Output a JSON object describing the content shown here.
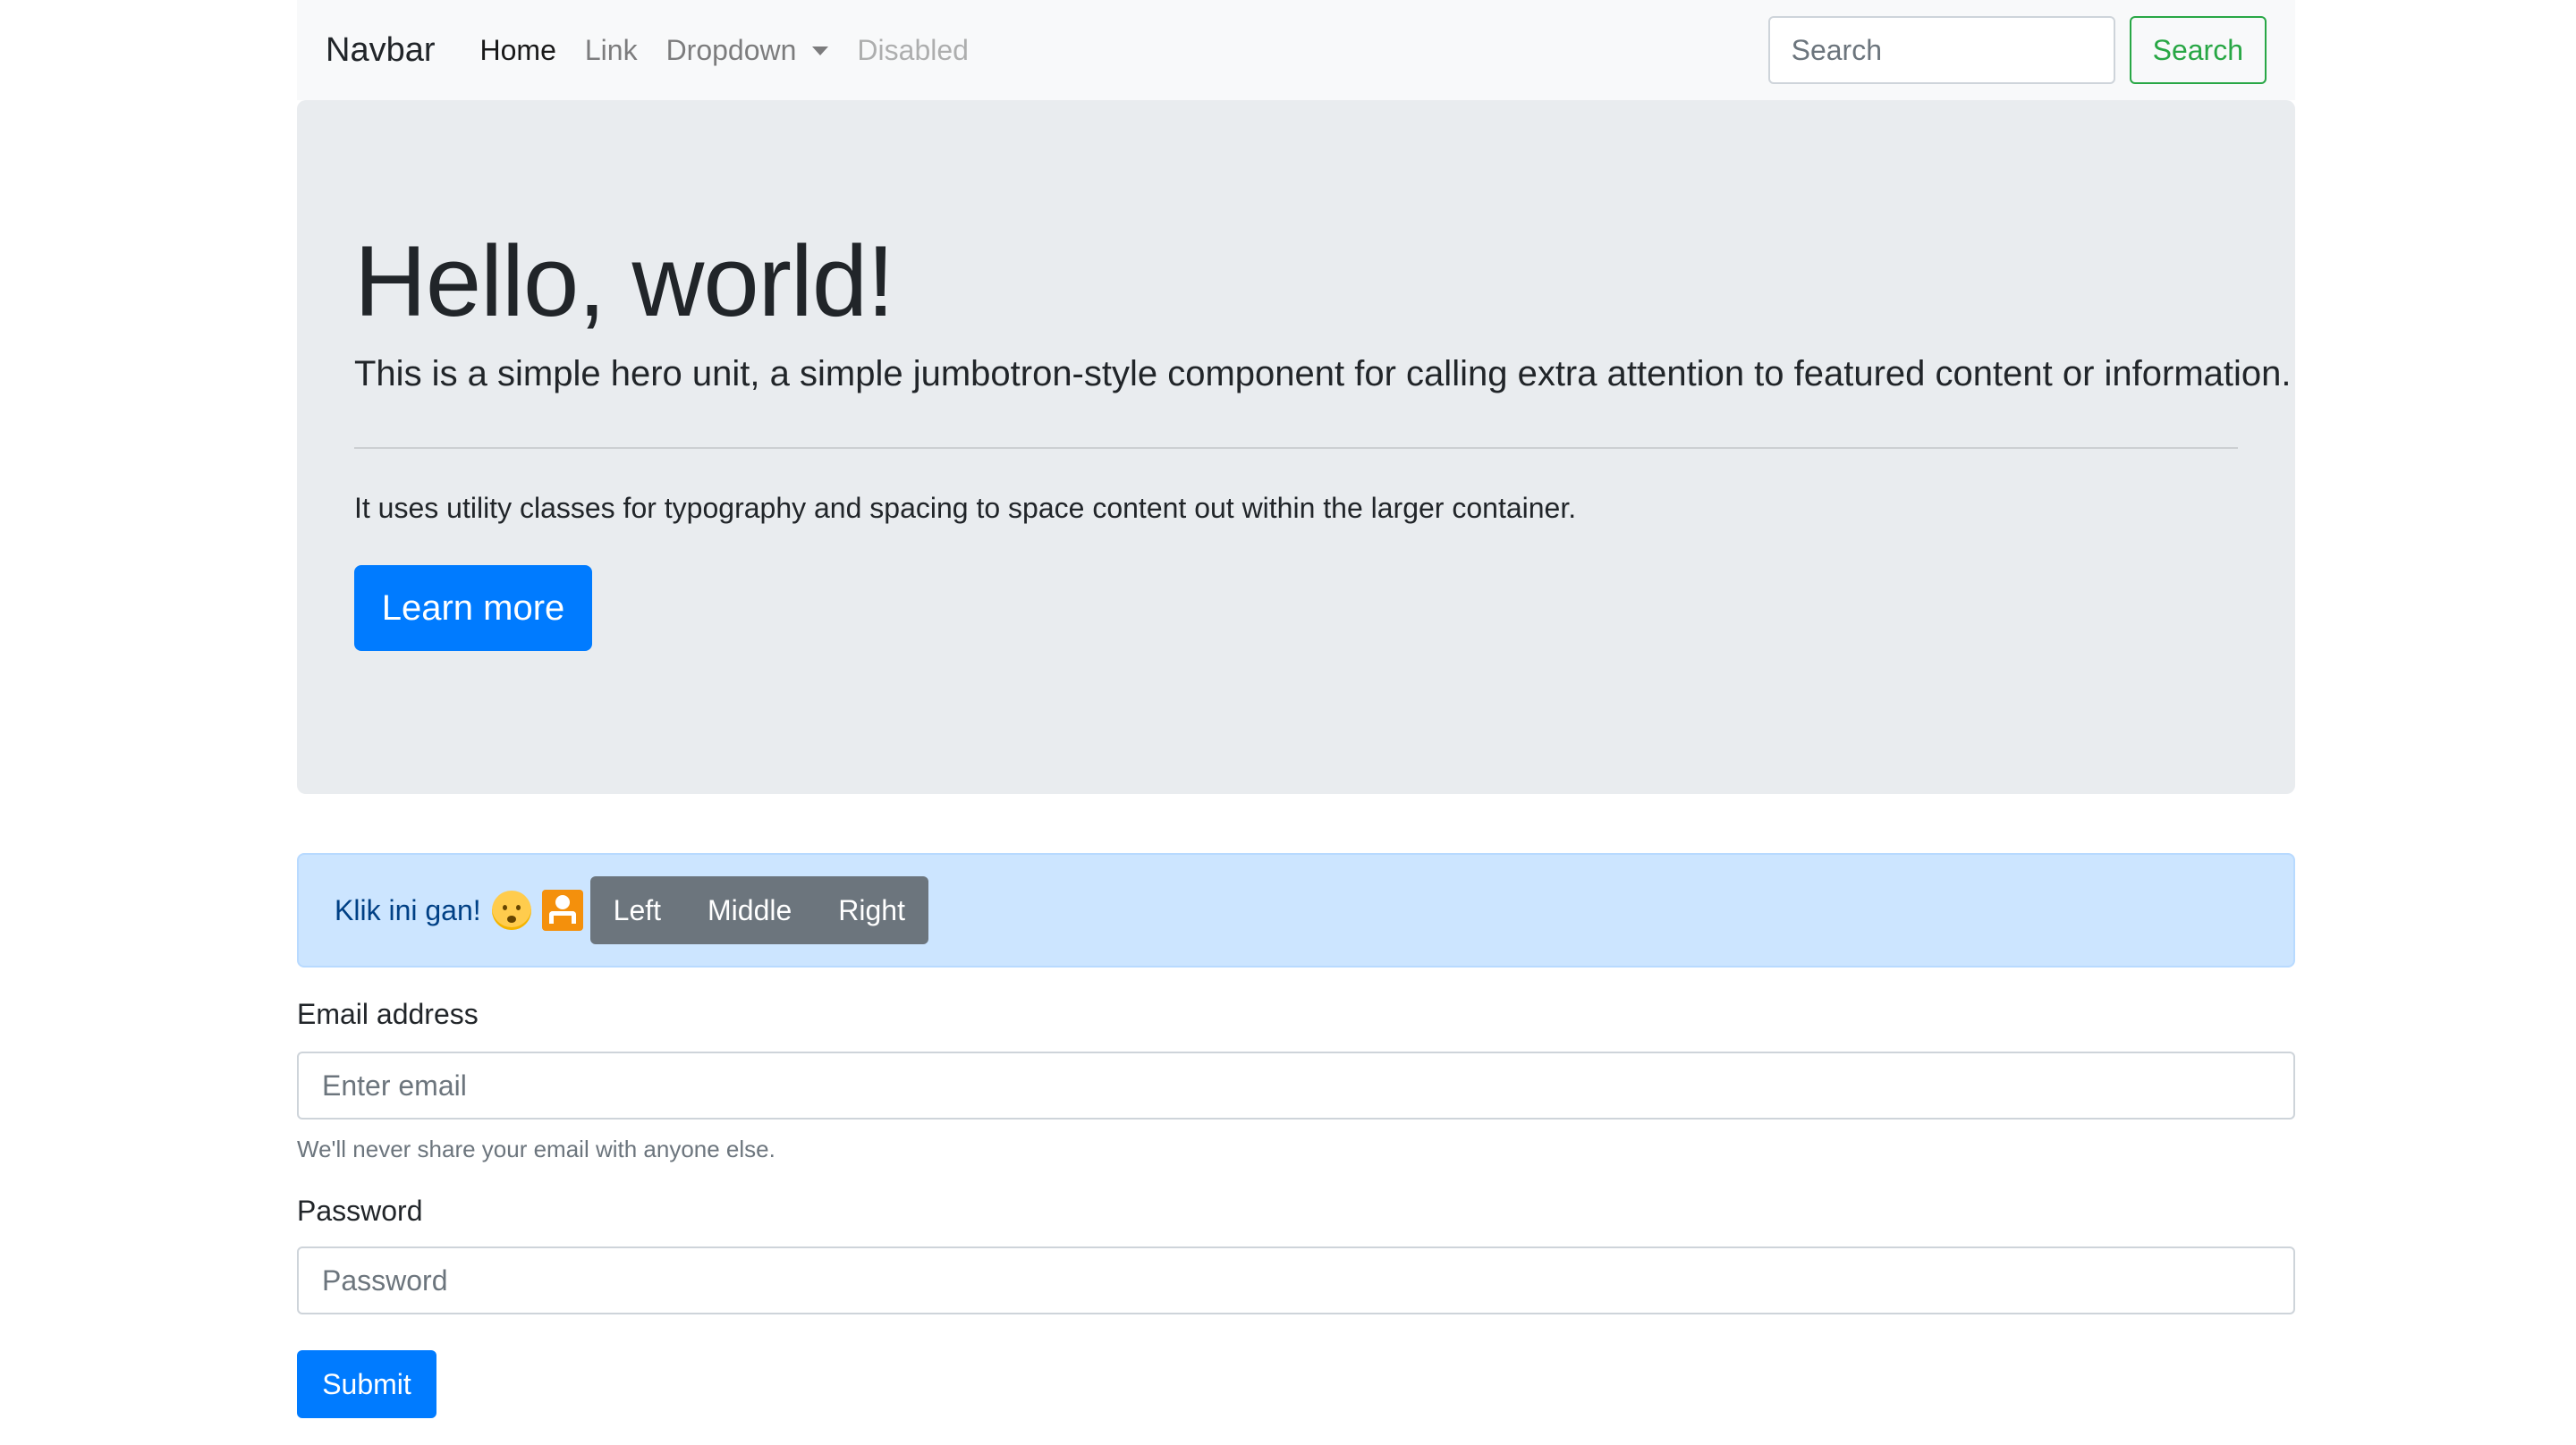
{
  "navbar": {
    "brand": "Navbar",
    "links": [
      {
        "label": "Home"
      },
      {
        "label": "Link"
      },
      {
        "label": "Dropdown"
      },
      {
        "label": "Disabled"
      }
    ],
    "search_placeholder": "Search",
    "search_button": "Search"
  },
  "jumbotron": {
    "title": "Hello, world!",
    "lead": "This is a simple hero unit, a simple jumbotron-style component for calling extra attention to featured content or information.",
    "text": "It uses utility classes for typography and spacing to space content out within the larger container.",
    "button": "Learn more"
  },
  "alert": {
    "text": "Klik ini gan!",
    "icons": [
      "baby-emoji-icon",
      "person-box-icon"
    ],
    "button_group": [
      "Left",
      "Middle",
      "Right"
    ]
  },
  "form": {
    "email_label": "Email address",
    "email_placeholder": "Enter email",
    "email_help": "We'll never share your email with anyone else.",
    "password_label": "Password",
    "password_placeholder": "Password",
    "submit": "Submit"
  },
  "colors": {
    "primary": "#007bff",
    "success": "#28a745",
    "secondary": "#6c757d",
    "alert_bg": "#cce5ff",
    "alert_text": "#004085",
    "jumbotron_bg": "#e9ecef",
    "navbar_bg": "#f8f9fa"
  }
}
